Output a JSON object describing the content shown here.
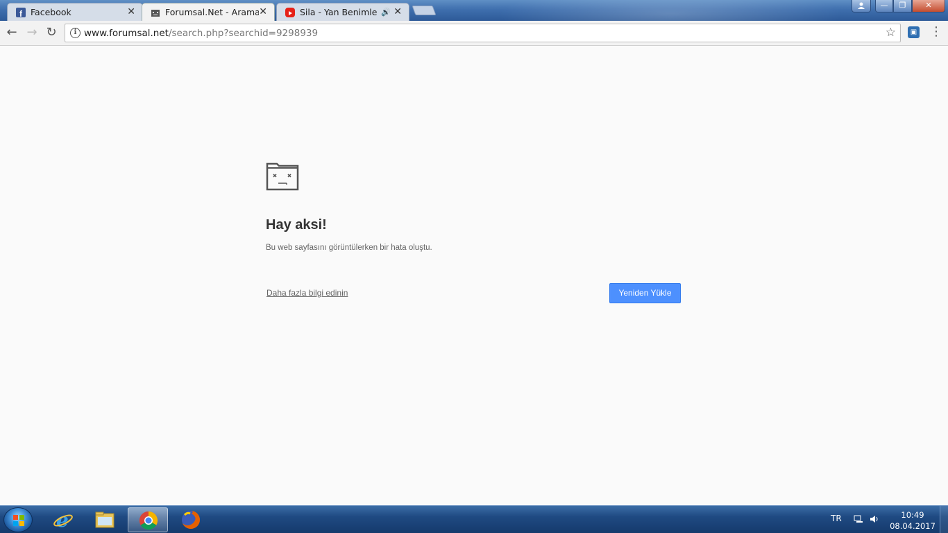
{
  "tabs": [
    {
      "title": "Facebook",
      "favicon": "facebook-icon"
    },
    {
      "title": "Forumsal.Net - Arama Sonuçları",
      "favicon": "sad-folder-icon"
    },
    {
      "title": "Sila - Yan Benimle - YouTube",
      "favicon": "youtube-icon"
    }
  ],
  "address": {
    "host": "www.forumsal.net",
    "path": "/search.php?searchid=9298939"
  },
  "error": {
    "title": "Hay aksi!",
    "description": "Bu web sayfasını görüntülerken bir hata oluştu.",
    "more_link": "Daha fazla bilgi edinin",
    "reload_label": "Yeniden Yükle"
  },
  "taskbar": {
    "apps": [
      "internet-explorer-icon",
      "file-explorer-icon",
      "chrome-icon",
      "firefox-icon"
    ],
    "language": "TR",
    "time": "10:49",
    "date": "08.04.2017"
  },
  "colors": {
    "accent_button": "#4d90fe",
    "page_background": "#fafafa",
    "taskbar": "#1f4a82"
  }
}
